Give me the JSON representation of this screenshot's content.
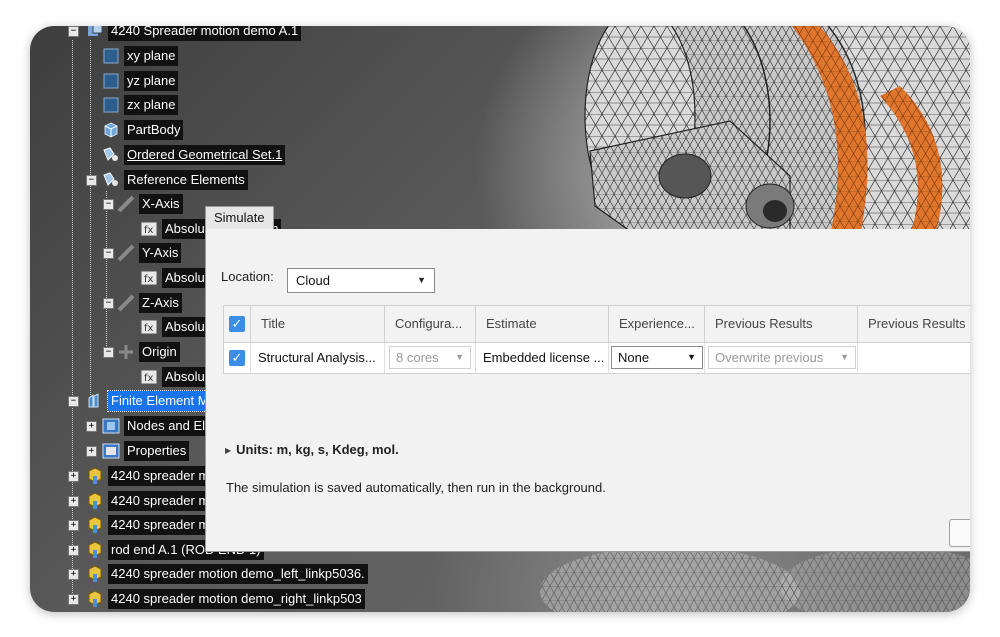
{
  "tree": {
    "items": [
      {
        "label": "4240 Spreader motion demo A.1"
      },
      {
        "label": "xy plane"
      },
      {
        "label": "yz plane"
      },
      {
        "label": "zx plane"
      },
      {
        "label": "PartBody"
      },
      {
        "label": "Ordered Geometrical Set.1"
      },
      {
        "label": "Reference Elements"
      },
      {
        "label": "X-Axis"
      },
      {
        "label": "AbsoluteAxisParam"
      },
      {
        "label": "Y-Axis"
      },
      {
        "label": "Absolu"
      },
      {
        "label": "Z-Axis"
      },
      {
        "label": "Absolu"
      },
      {
        "label": "Origin"
      },
      {
        "label": "Absolu"
      },
      {
        "label": "Finite Element M"
      },
      {
        "label": "Nodes and El"
      },
      {
        "label": "Properties"
      },
      {
        "label": "4240 spreader m"
      },
      {
        "label": "4240 spreader m"
      },
      {
        "label": "4240 spreader m"
      },
      {
        "label": "rod end A.1 (ROD END 1)"
      },
      {
        "label": "4240 spreader motion demo_left_linkp5036."
      },
      {
        "label": "4240 spreader motion demo_right_linkp503"
      }
    ]
  },
  "dialog": {
    "tab": "Simulate",
    "location_label": "Location:",
    "location_value": "Cloud",
    "columns": [
      "Title",
      "Configura...",
      "Estimate",
      "Experience...",
      "Previous Results",
      "Previous Results D"
    ],
    "row": {
      "title": "Structural Analysis...",
      "configuration": "8 cores",
      "estimate": "Embedded license ...",
      "experience": "None",
      "previous_results": "Overwrite previous",
      "previous_results_d": ""
    },
    "units": "Units: m, kg, s, Kdeg, mol.",
    "description": "The simulation is saved automatically, then run in the background."
  },
  "colors": {
    "selection": "#1874e8",
    "checkbox": "#3a8ee6",
    "mesh_orange": "#e0752c"
  }
}
